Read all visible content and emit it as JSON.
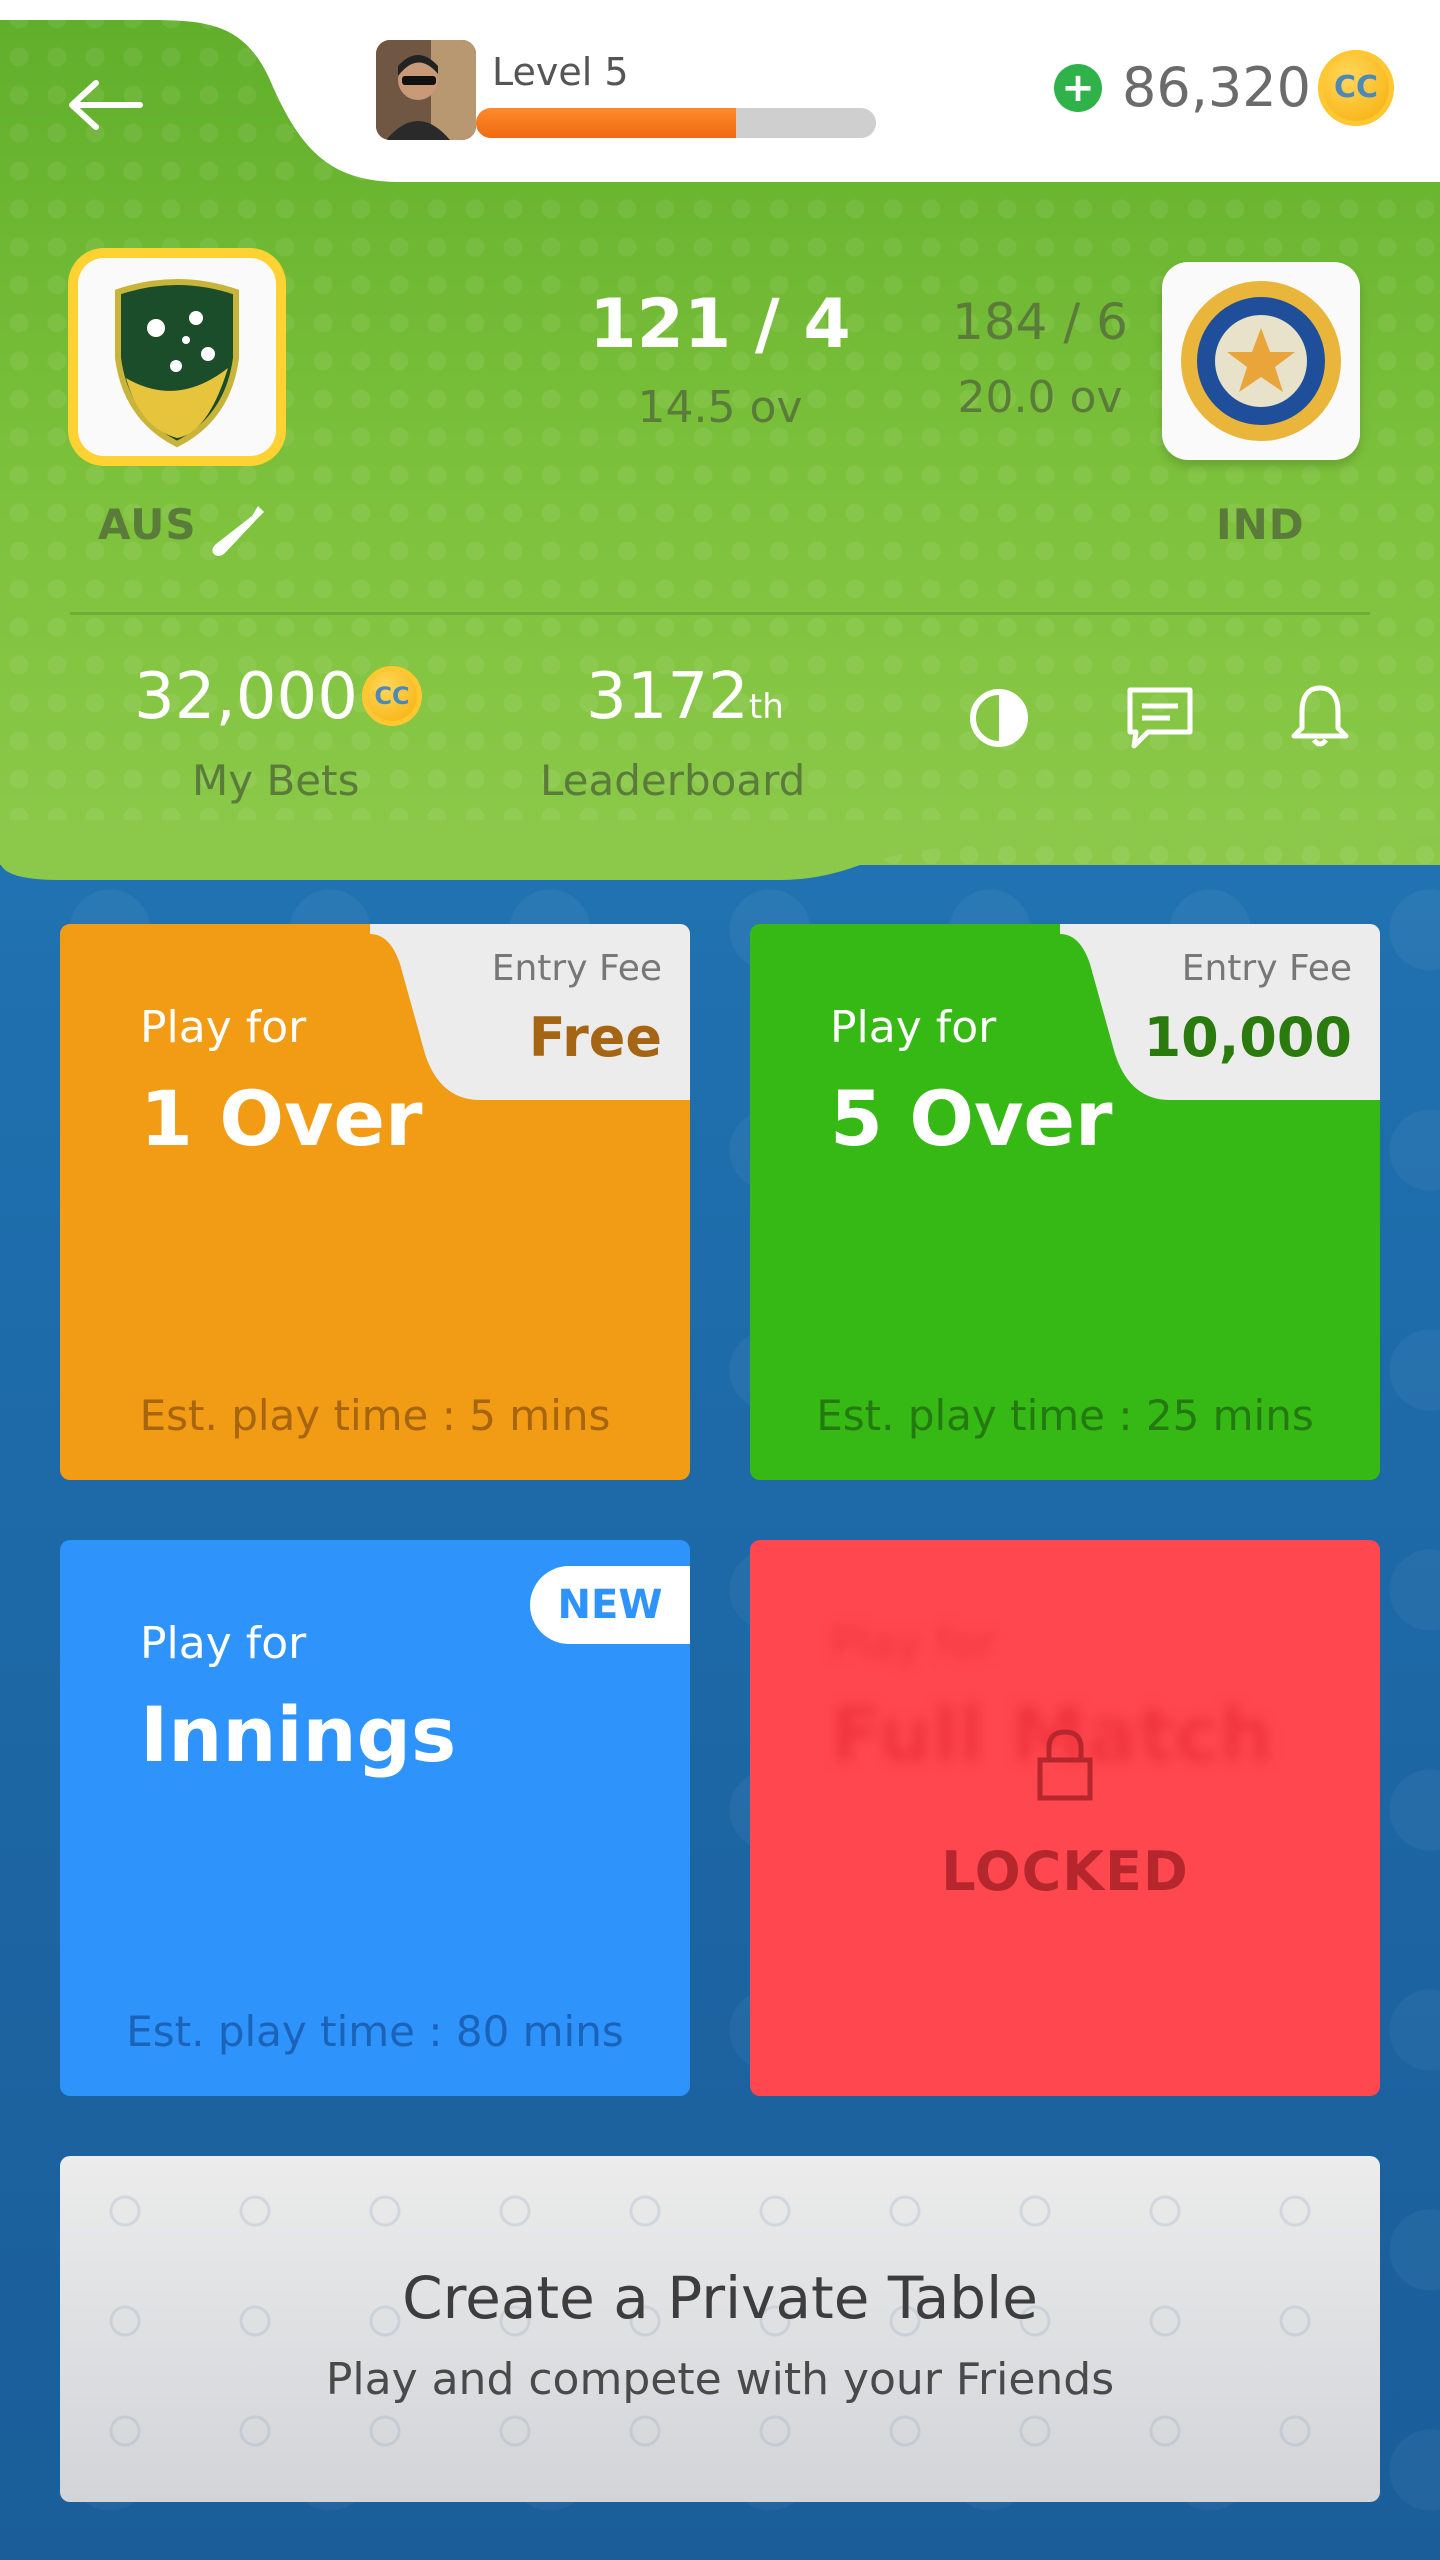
{
  "profile": {
    "level_label": "Level 5",
    "xp_progress": 0.65,
    "coins": "86,320",
    "coin_symbol": "CC"
  },
  "match": {
    "team1": {
      "name": "AUS",
      "score": "121 / 4",
      "overs": "14.5 ov"
    },
    "team2": {
      "name": "IND",
      "score": "184 / 6",
      "overs": "20.0 ov"
    }
  },
  "stats": {
    "bets_value": "32,000",
    "bets_label": "My Bets",
    "rank_value": "3172",
    "rank_suffix": "th",
    "rank_label": "Leaderboard"
  },
  "cards": {
    "one_over": {
      "entry_fee_label": "Entry Fee",
      "entry_fee": "Free",
      "play_for": "Play for",
      "title": "1 Over",
      "play_time": "Est. play time : 5 mins"
    },
    "five_over": {
      "entry_fee_label": "Entry Fee",
      "entry_fee": "10,000",
      "play_for": "Play for",
      "title": "5 Over",
      "play_time": "Est. play time : 25 mins"
    },
    "innings": {
      "badge": "NEW",
      "play_for": "Play for",
      "title": "Innings",
      "play_time": "Est. play time : 80 mins"
    },
    "full_match": {
      "play_for": "Play for",
      "title": "Full Match",
      "locked_label": "LOCKED"
    }
  },
  "private_table": {
    "title": "Create a Private Table",
    "subtitle": "Play and compete with your Friends"
  },
  "colors": {
    "orange_card": "#f29b14",
    "green_card": "#37b915",
    "blue_card": "#2e93fb",
    "red_card": "#ff474f"
  }
}
